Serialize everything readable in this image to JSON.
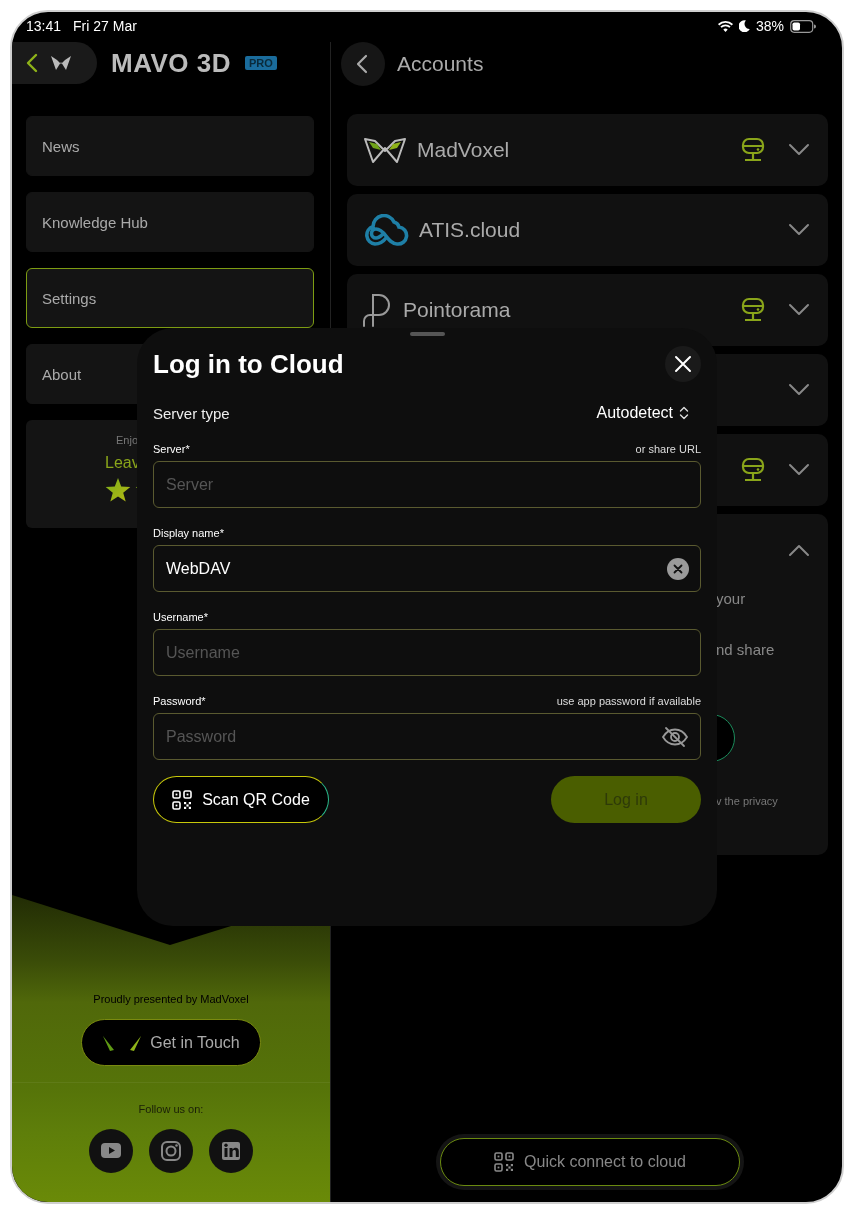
{
  "status_bar": {
    "time": "13:41",
    "date": "Fri 27 Mar",
    "battery": "38%"
  },
  "sidebar": {
    "app_title": "MAVO 3D",
    "badge": "PRO",
    "items": [
      {
        "label": "News",
        "selected": false
      },
      {
        "label": "Knowledge Hub",
        "selected": false
      },
      {
        "label": "Settings",
        "selected": true
      },
      {
        "label": "About",
        "selected": false
      }
    ],
    "rating": {
      "line_1": "Enjo",
      "line_2": "Leav"
    },
    "footer": {
      "credit": "Proudly presented by MadVoxel",
      "contact_button": "Get in Touch",
      "follow_label": "Follow us on:",
      "social": [
        {
          "kind": "youtube"
        },
        {
          "kind": "instagram"
        },
        {
          "kind": "linkedin"
        }
      ]
    }
  },
  "accounts": {
    "title": "Accounts",
    "items": [
      {
        "kind": "madvoxel",
        "name": "MadVoxel",
        "server": true,
        "expanded": false
      },
      {
        "kind": "atis",
        "name": "ATIS.cloud",
        "server": false,
        "expanded": false
      },
      {
        "kind": "pointorama",
        "name": "Pointorama",
        "server": true,
        "expanded": false
      },
      {
        "kind": "none",
        "server": false,
        "expanded": false
      },
      {
        "kind": "none",
        "server": true,
        "expanded": false
      },
      {
        "kind": "none",
        "server": false,
        "expanded": true,
        "lines": [
          "your",
          "nd share"
        ],
        "note": "v the privacy"
      }
    ],
    "quick_connect": "Quick connect to cloud"
  },
  "dialog": {
    "title": "Log in to Cloud",
    "server_type_label": "Server type",
    "server_type_value": "Autodetect",
    "fields": [
      {
        "kind": "text",
        "label": "Server*",
        "hint": "or share URL",
        "placeholder": "Server"
      },
      {
        "kind": "clearable",
        "label": "Display name*",
        "value": "WebDAV"
      },
      {
        "kind": "text",
        "label": "Username*",
        "placeholder": "Username"
      },
      {
        "kind": "password",
        "label": "Password*",
        "hint": "use app password if available",
        "placeholder": "Password"
      }
    ],
    "scan_button": "Scan QR Code",
    "login_button": {
      "label": "Log in",
      "disabled": true
    }
  }
}
